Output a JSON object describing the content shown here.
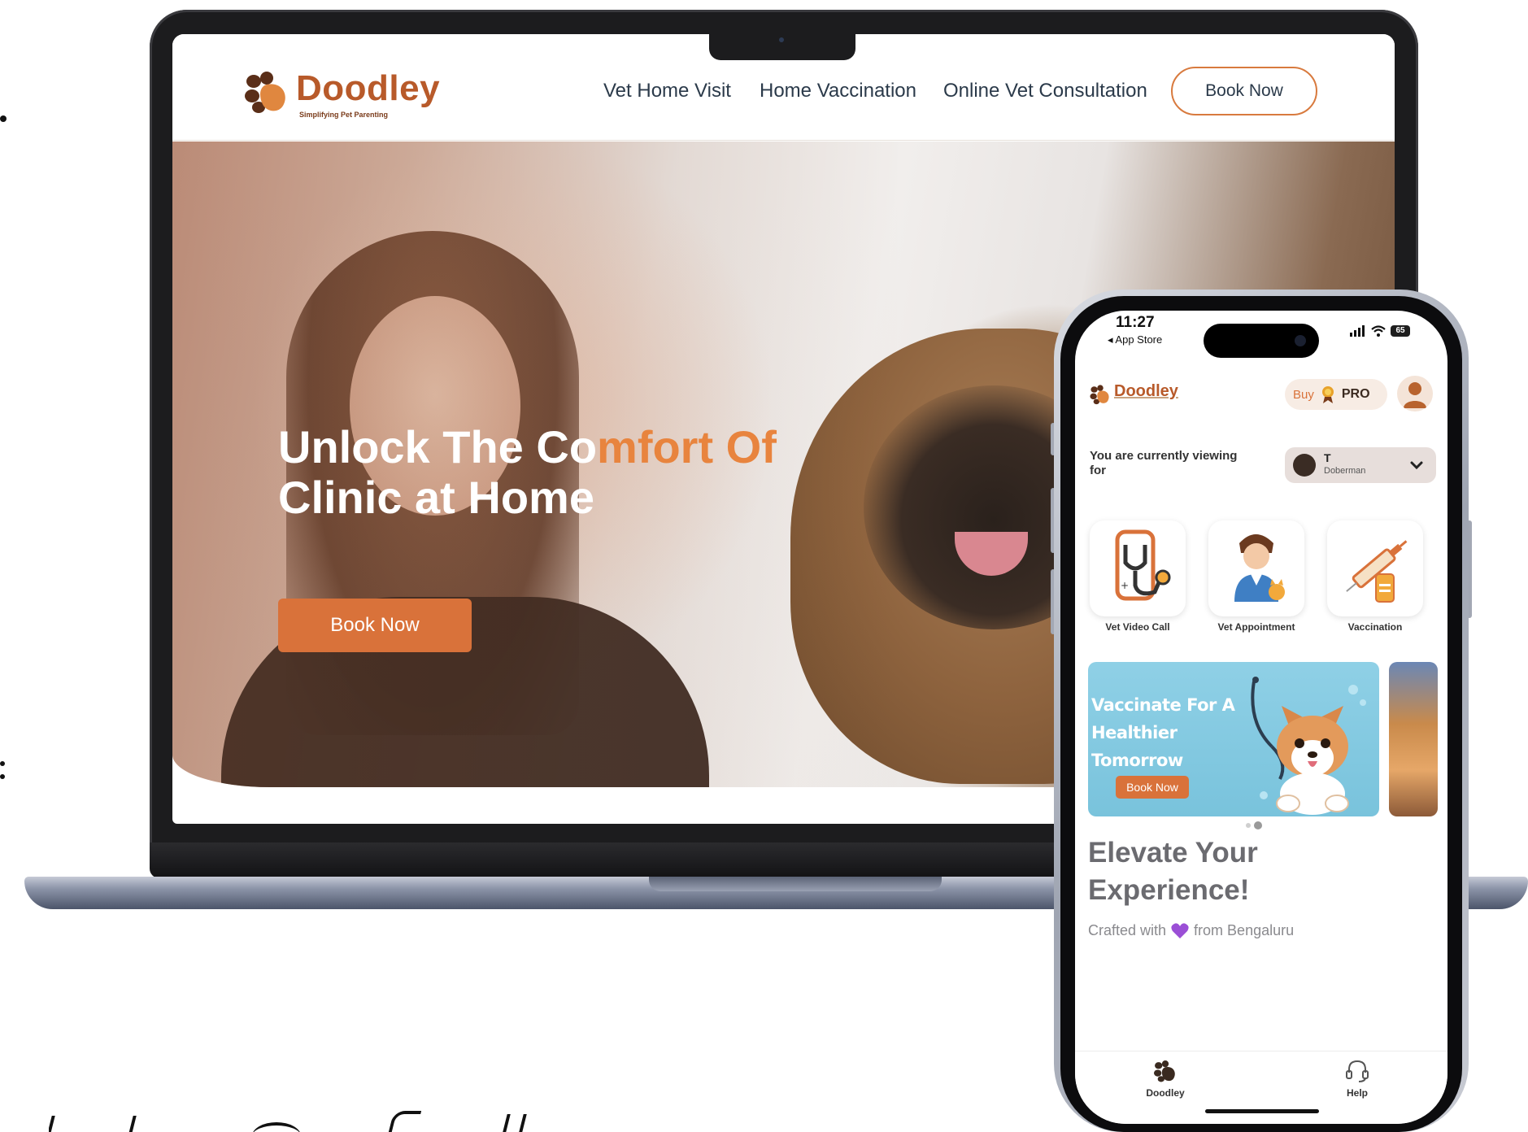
{
  "laptop": {
    "brand": {
      "name": "Doodley",
      "tagline": "Simplifying Pet Parenting"
    },
    "nav": {
      "items": [
        {
          "label": "Vet Home Visit"
        },
        {
          "label": "Home Vaccination"
        },
        {
          "label": "Online Vet Consultation"
        }
      ],
      "cta_label": "Book Now"
    },
    "hero": {
      "title_line1_white": "Unlock The Co",
      "title_line1_accent": "mfort Of",
      "title_line2": "Clinic at Home",
      "button_label": "Book Now"
    }
  },
  "phone": {
    "status": {
      "time": "11:27",
      "back_label": "◂ App Store",
      "battery": "65"
    },
    "header": {
      "brand": "Doodley",
      "buy_label": "Buy",
      "pro_label": "PRO"
    },
    "pet_selector": {
      "prompt": "You are currently viewing for",
      "pet_name": "T",
      "pet_breed": "Doberman"
    },
    "services": [
      {
        "label": "Vet Video Call"
      },
      {
        "label": "Vet Appointment"
      },
      {
        "label": "Vaccination"
      }
    ],
    "banner": {
      "title": "Vaccinate For A Healthier Tomorrow",
      "button_label": "Book Now"
    },
    "promo": {
      "headline": "Elevate Your Experience!",
      "crafted_prefix": "Crafted with",
      "crafted_suffix": "from Bengaluru"
    },
    "tabbar": [
      {
        "label": "Doodley"
      },
      {
        "label": "Help"
      }
    ]
  },
  "colors": {
    "brand_orange": "#d9723a",
    "brand_brown": "#b85a2a",
    "nav_text": "#2b3a4a"
  }
}
